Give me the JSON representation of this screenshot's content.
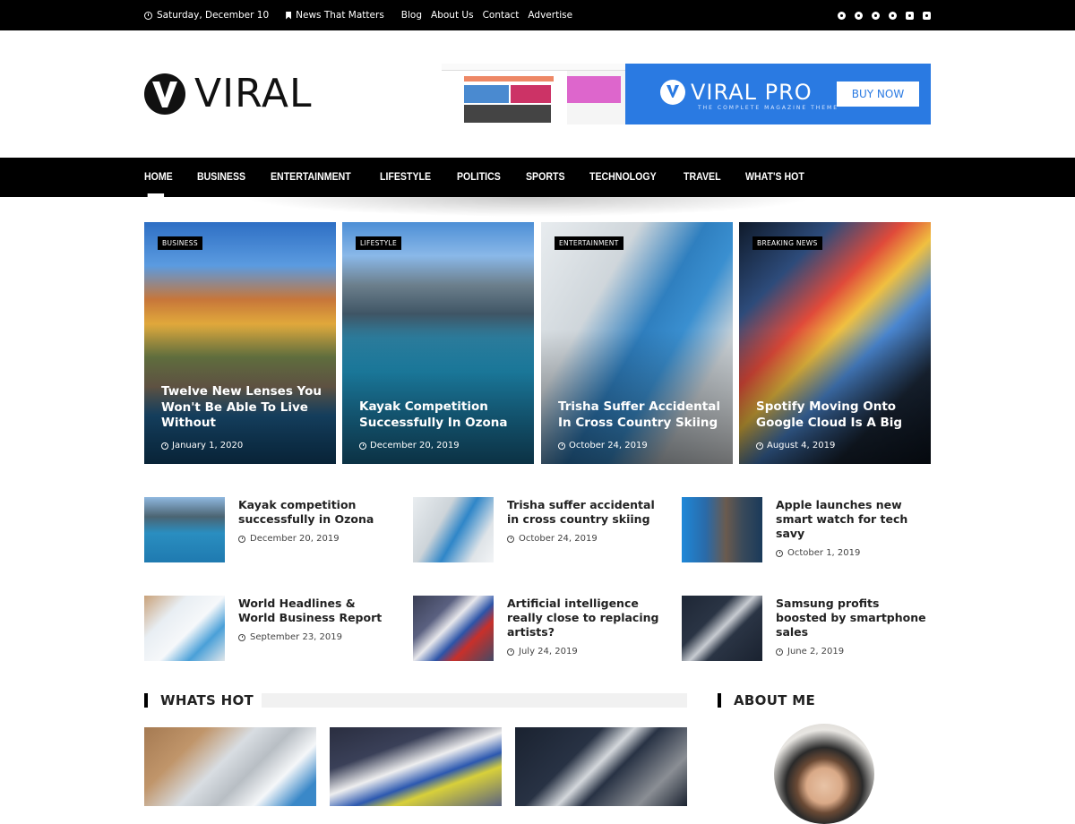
{
  "topbar": {
    "date": "Saturday, December 10",
    "tagline": "News That Matters",
    "links": [
      "Blog",
      "About Us",
      "Contact",
      "Advertise"
    ],
    "social_icons": [
      "facebook-icon",
      "twitter-icon",
      "pinterest-icon",
      "youtube-icon",
      "linkedin-icon",
      "instagram-icon"
    ]
  },
  "header": {
    "logo_text": "VIRAL",
    "banner": {
      "brand": "VIRAL PRO",
      "subtitle": "THE COMPLETE MAGAZINE THEME",
      "button": "BUY NOW"
    }
  },
  "nav": {
    "items": [
      "HOME",
      "BUSINESS",
      "ENTERTAINMENT",
      "LIFESTYLE",
      "POLITICS",
      "SPORTS",
      "TECHNOLOGY",
      "TRAVEL",
      "WHAT'S HOT"
    ],
    "active": "HOME"
  },
  "featured": [
    {
      "category": "BUSINESS",
      "title": "Twelve New Lenses You Won't Be Able To Live Without",
      "date": "January 1, 2020"
    },
    {
      "category": "LIFESTYLE",
      "title": "Kayak Competition Successfully In Ozona",
      "date": "December 20, 2019"
    },
    {
      "category": "ENTERTAINMENT",
      "title": "Trisha Suffer Accidental In Cross Country Skiing",
      "date": "October 24, 2019"
    },
    {
      "category": "BREAKING NEWS",
      "title": "Spotify Moving Onto Google Cloud Is A Big",
      "date": "August 4, 2019"
    }
  ],
  "posts": [
    {
      "title": "Kayak competition successfully in Ozona",
      "date": "December 20, 2019"
    },
    {
      "title": "Trisha suffer accidental in cross country skiing",
      "date": "October 24, 2019"
    },
    {
      "title": "Apple launches new smart watch for tech savy",
      "date": "October 1, 2019"
    },
    {
      "title": "World Headlines & World Business Report",
      "date": "September 23, 2019"
    },
    {
      "title": "Artificial intelligence really close to replacing artists?",
      "date": "July 24, 2019"
    },
    {
      "title": "Samsung profits boosted by smartphone sales",
      "date": "June 2, 2019"
    }
  ],
  "sections": {
    "whats_hot": "WHATS HOT",
    "about_me": "ABOUT ME"
  }
}
